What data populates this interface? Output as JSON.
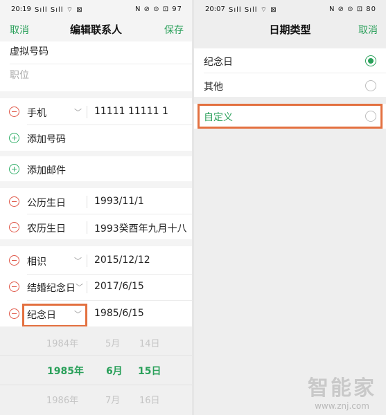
{
  "left": {
    "status": {
      "time": "20:19",
      "signal": "Sıll Sıll ⌔ ⊠",
      "right_icons": "N ⊘ ⊙ ⊡ 97"
    },
    "header": {
      "cancel": "取消",
      "title": "编辑联系人",
      "save": "保存"
    },
    "virtual_number": "虚拟号码",
    "position_placeholder": "职位",
    "phone": {
      "label": "手机",
      "value": "11111 11111 1"
    },
    "add_number": "添加号码",
    "add_email": "添加邮件",
    "solar_birthday": {
      "label": "公历生日",
      "value": "1993/11/1"
    },
    "lunar_birthday": {
      "label": "农历生日",
      "value": "1993癸酉年九月十八"
    },
    "acquaintance": {
      "label": "相识",
      "value": "2015/12/12"
    },
    "wedding": {
      "label": "结婚纪念日",
      "value": "2017/6/15"
    },
    "anniversary": {
      "label": "纪念日",
      "value": "1985/6/15"
    },
    "picker": {
      "prev": {
        "year": "1984年",
        "month": "5月",
        "day": "14日"
      },
      "current": {
        "year": "1985年",
        "month": "6月",
        "day": "15日"
      },
      "next": {
        "year": "1986年",
        "month": "7月",
        "day": "16日"
      }
    }
  },
  "right": {
    "status": {
      "time": "20:07",
      "signal": "Sıll Sıll ⌔ ⊠",
      "right_icons": "N ⊘ ⊙ ⊡ 80"
    },
    "header": {
      "title": "日期类型",
      "cancel": "取消"
    },
    "options": [
      {
        "label": "纪念日",
        "selected": true
      },
      {
        "label": "其他",
        "selected": false
      },
      {
        "label": "自定义",
        "selected": false
      }
    ]
  },
  "watermark": {
    "logo": "智能家",
    "url": "www.znj.com"
  },
  "colors": {
    "accent": "#2aa05a",
    "remove": "#e0594a",
    "highlight": "#e3703f"
  }
}
